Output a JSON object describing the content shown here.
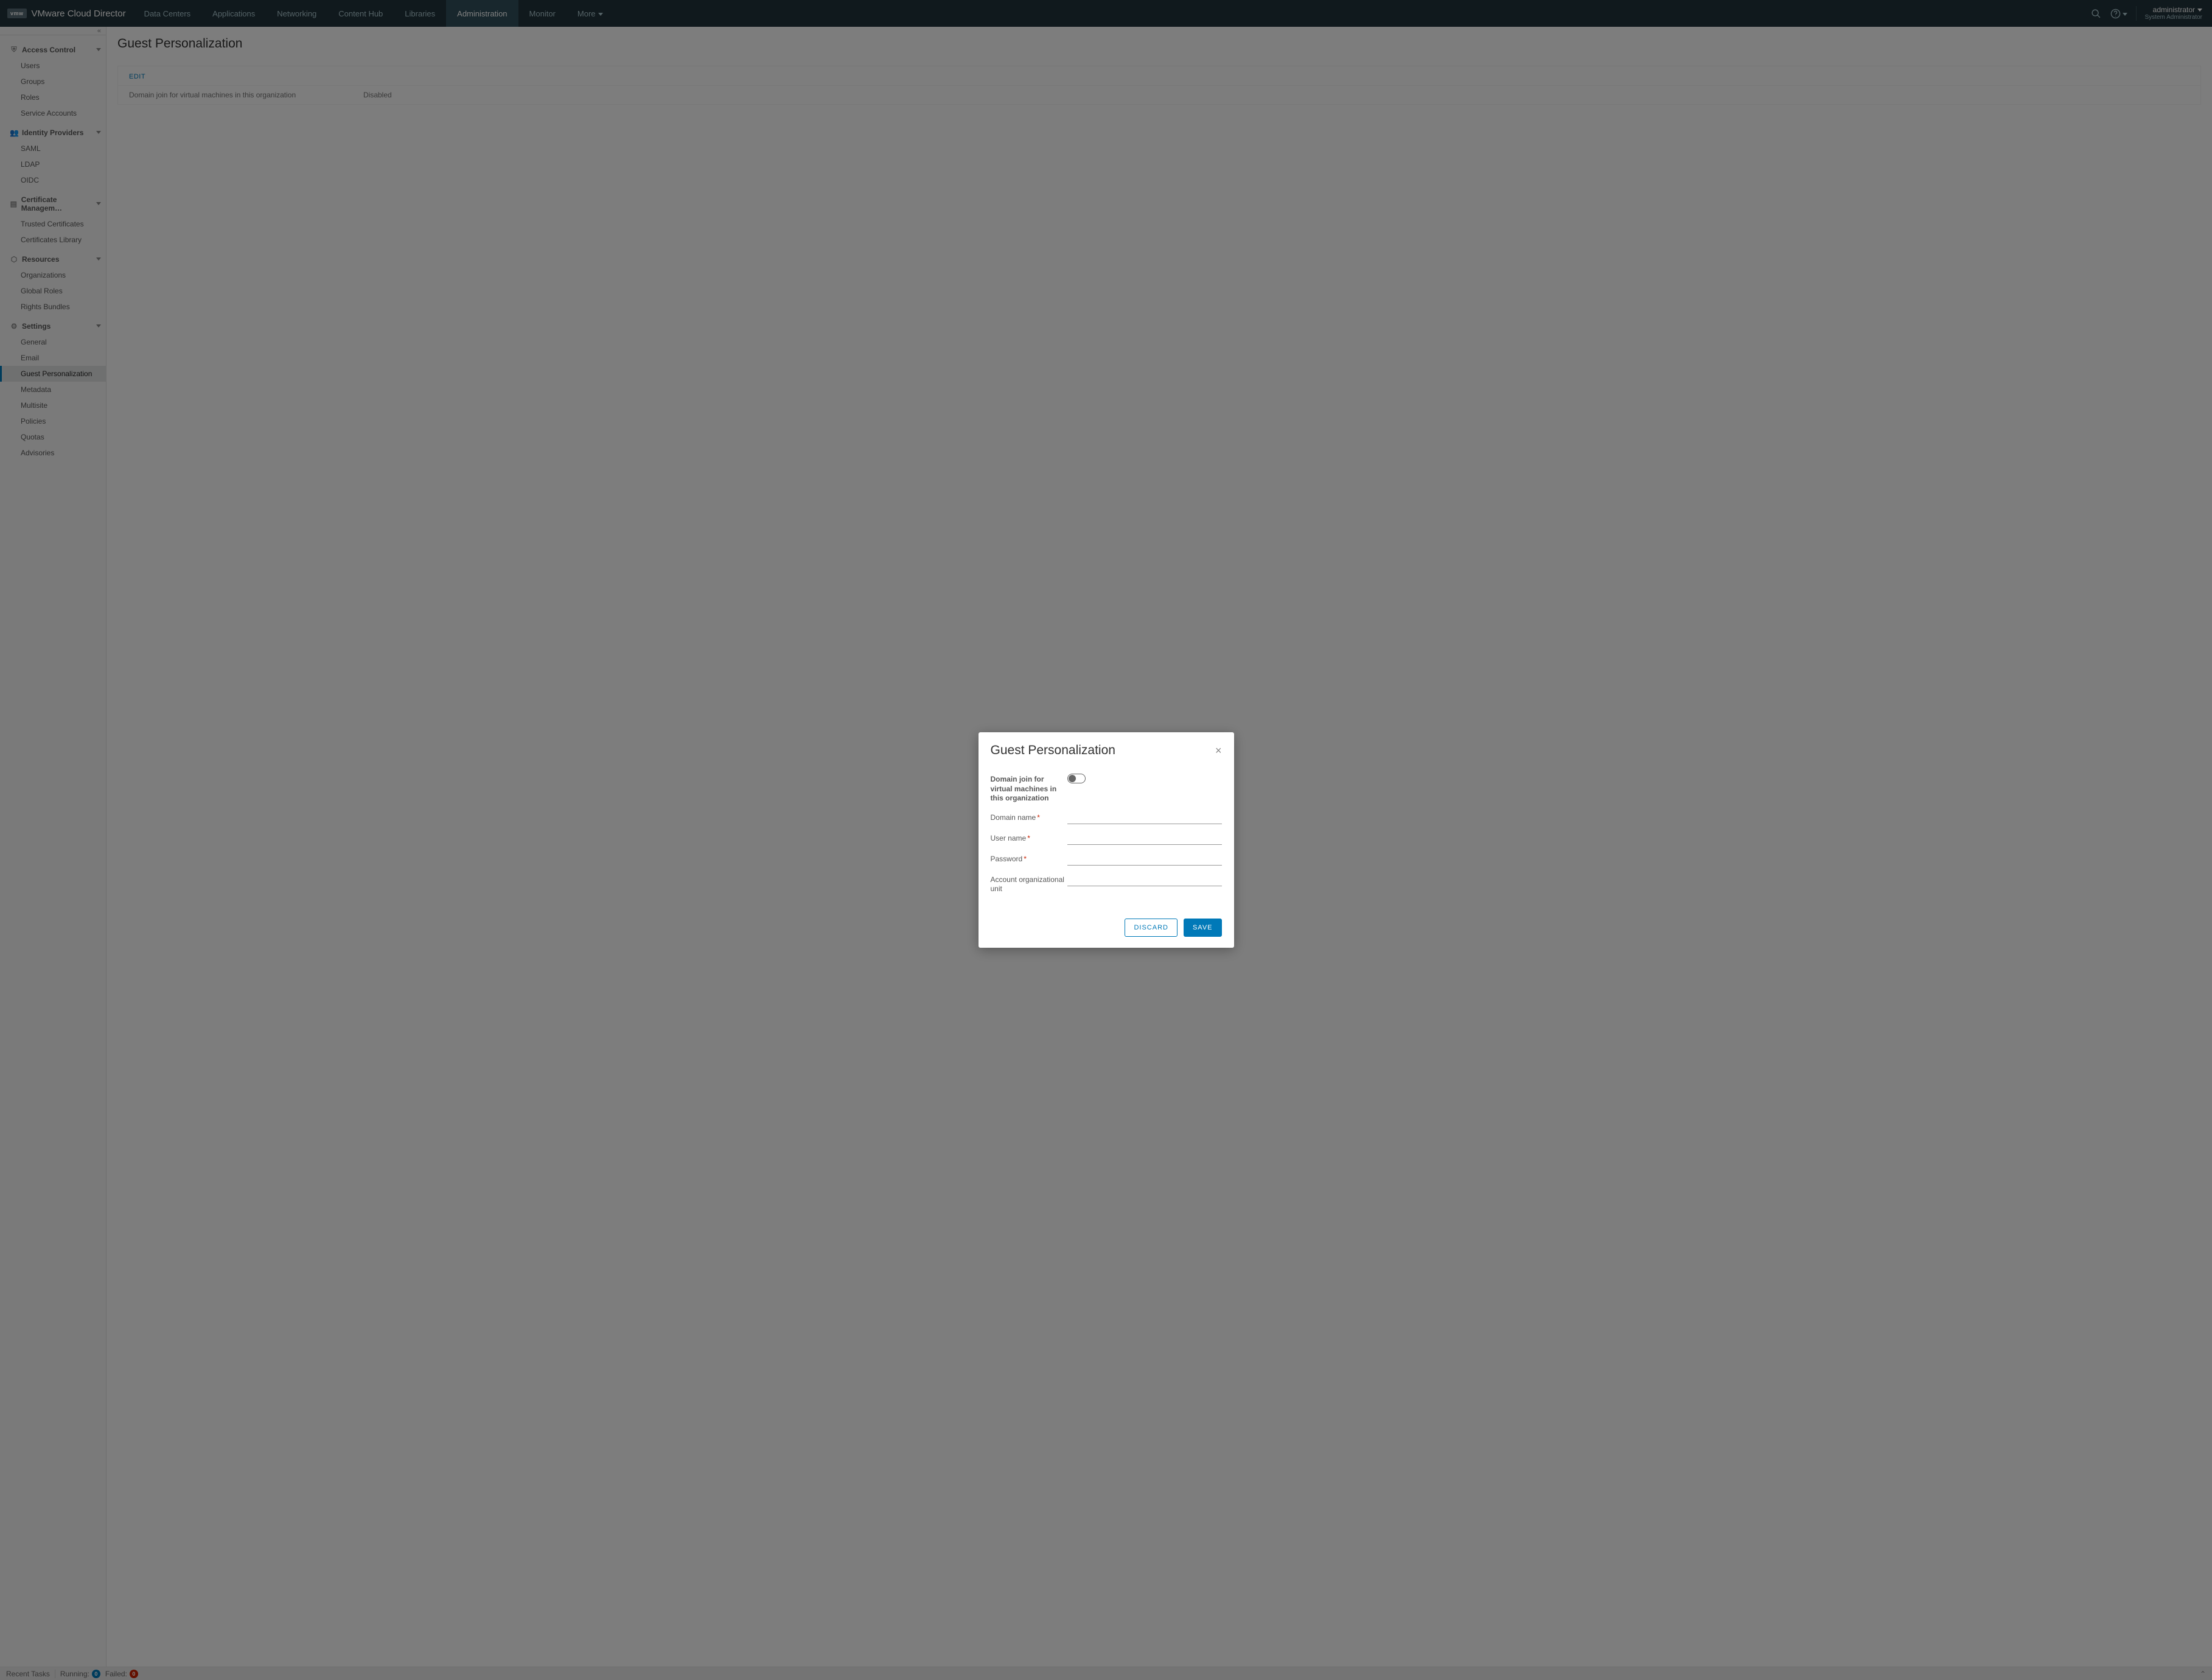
{
  "header": {
    "logo_text": "vmw",
    "product": "VMware Cloud Director",
    "tabs": [
      {
        "label": "Data Centers",
        "active": false
      },
      {
        "label": "Applications",
        "active": false
      },
      {
        "label": "Networking",
        "active": false
      },
      {
        "label": "Content Hub",
        "active": false
      },
      {
        "label": "Libraries",
        "active": false
      },
      {
        "label": "Administration",
        "active": true
      },
      {
        "label": "Monitor",
        "active": false
      },
      {
        "label": "More",
        "active": false,
        "dropdown": true
      }
    ],
    "user": {
      "name": "administrator",
      "role": "System Administrator"
    }
  },
  "sidebar": {
    "groups": [
      {
        "label": "Access Control",
        "icon": "shield",
        "expanded": true,
        "items": [
          {
            "label": "Users"
          },
          {
            "label": "Groups"
          },
          {
            "label": "Roles"
          },
          {
            "label": "Service Accounts"
          }
        ]
      },
      {
        "label": "Identity Providers",
        "icon": "users",
        "expanded": true,
        "items": [
          {
            "label": "SAML"
          },
          {
            "label": "LDAP"
          },
          {
            "label": "OIDC"
          }
        ]
      },
      {
        "label": "Certificate Managem…",
        "icon": "cert",
        "expanded": true,
        "items": [
          {
            "label": "Trusted Certificates"
          },
          {
            "label": "Certificates Library"
          }
        ]
      },
      {
        "label": "Resources",
        "icon": "resource",
        "expanded": true,
        "items": [
          {
            "label": "Organizations"
          },
          {
            "label": "Global Roles"
          },
          {
            "label": "Rights Bundles"
          }
        ]
      },
      {
        "label": "Settings",
        "icon": "cog",
        "expanded": true,
        "items": [
          {
            "label": "General"
          },
          {
            "label": "Email"
          },
          {
            "label": "Guest Personalization",
            "active": true
          },
          {
            "label": "Metadata"
          },
          {
            "label": "Multisite"
          },
          {
            "label": "Policies"
          },
          {
            "label": "Quotas"
          },
          {
            "label": "Advisories"
          }
        ]
      }
    ]
  },
  "page": {
    "title": "Guest Personalization",
    "edit_label": "EDIT",
    "row_label": "Domain join for virtual machines in this organization",
    "row_value": "Disabled"
  },
  "modal": {
    "title": "Guest Personalization",
    "toggle_label": "Domain join for virtual machines in this organization",
    "toggle_on": false,
    "fields": [
      {
        "label": "Domain name",
        "required": true,
        "value": ""
      },
      {
        "label": "User name",
        "required": true,
        "value": ""
      },
      {
        "label": "Password",
        "required": true,
        "value": "",
        "type": "password"
      },
      {
        "label": "Account organizational unit",
        "required": false,
        "value": ""
      }
    ],
    "discard_label": "DISCARD",
    "save_label": "SAVE"
  },
  "footer": {
    "recent_tasks_label": "Recent Tasks",
    "running_label": "Running:",
    "running_count": "0",
    "failed_label": "Failed:",
    "failed_count": "0"
  }
}
